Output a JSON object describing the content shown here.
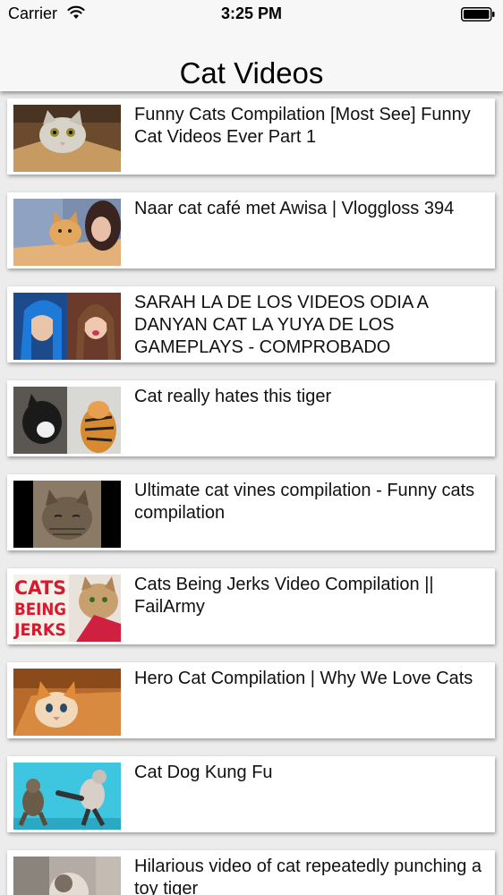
{
  "status_bar": {
    "carrier": "Carrier",
    "time": "3:25 PM",
    "wifi_icon": "wifi-icon",
    "battery_icon": "battery-icon"
  },
  "nav": {
    "title": "Cat Videos"
  },
  "videos": [
    {
      "title": "Funny Cats Compilation [Most See] Funny Cat Videos Ever Part 1",
      "thumbnail": "cat-in-box-thumbnail"
    },
    {
      "title": "Naar cat café met Awisa | Vloggloss 394",
      "thumbnail": "cat-cafe-thumbnail"
    },
    {
      "title": "SARAH LA DE LOS VIDEOS ODIA A DANYAN CAT LA YUYA DE LOS GAMEPLAYS - COMPROBADO",
      "thumbnail": "two-girls-thumbnail"
    },
    {
      "title": "Cat really hates this tiger",
      "thumbnail": "cat-and-tiger-thumbnail"
    },
    {
      "title": "Ultimate cat vines compilation - Funny cats compilation",
      "thumbnail": "tabby-cat-thumbnail"
    },
    {
      "title": "Cats Being Jerks Video Compilation || FailArmy",
      "thumbnail": "cats-being-jerks-thumbnail",
      "thumb_text": [
        "CATS",
        "BEING",
        "JERKS"
      ]
    },
    {
      "title": "Hero Cat Compilation | Why We Love Cats",
      "thumbnail": "orange-kitten-thumbnail"
    },
    {
      "title": "Cat Dog Kung Fu",
      "thumbnail": "kung-fu-cats-thumbnail"
    },
    {
      "title": "Hilarious video of cat repeatedly punching a toy tiger",
      "thumbnail": "cat-punching-thumbnail"
    }
  ]
}
